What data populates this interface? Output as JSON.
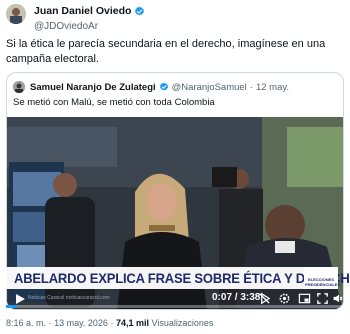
{
  "author": {
    "name": "Juan Daniel Oviedo",
    "handle": "@JDOviedoAr",
    "verified": true
  },
  "tweet": {
    "text": "Si la ética le parecía secundaria en el derecho, imagínese en una campaña electoral."
  },
  "quote": {
    "name": "Samuel Naranjo De Zulategi",
    "handle": "@NaranjoSamuel",
    "separator": "·",
    "date": "12 may.",
    "text": "Se metió con Malú, se metió con toda Colombia"
  },
  "video": {
    "headline": "ABELARDO EXPLICA FRASE SOBRE ÉTICA Y DERECHO",
    "ticker": "Noticias Caracol   noticiascaracol.com",
    "logo_text": "ELECCIONES PRESIDENCIALES",
    "time": "0:07 / 3:38",
    "progress_fraction": 0.032,
    "icons": [
      "play-icon",
      "no-autoplay-icon",
      "settings-icon",
      "pip-icon",
      "fullscreen-icon",
      "volume-icon"
    ]
  },
  "meta": {
    "time": "8:16 a. m.",
    "separator": "·",
    "date": "13 may. 2026",
    "views_count": "74,1 mil",
    "views_label": "Visualizaciones"
  },
  "colors": {
    "verified": "#1d9bf0",
    "headline_text": "#1f2a6b",
    "secondary_text": "#536471"
  }
}
